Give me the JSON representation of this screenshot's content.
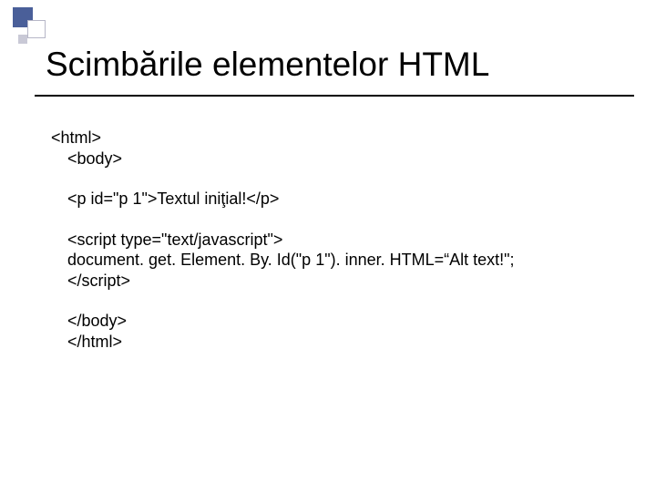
{
  "title": "Scimbările elementelor HTML",
  "code": {
    "l1": "<html>",
    "l2": "<body>",
    "l3": "<p id=\"p 1\">Textul iniţial!</p>",
    "l4": "<script type=\"text/javascript\">",
    "l5": "document. get. Element. By. Id(\"p 1\"). inner. HTML=“Alt text!\";",
    "l6": "</script>",
    "l7": "</body>",
    "l8": "</html>"
  }
}
